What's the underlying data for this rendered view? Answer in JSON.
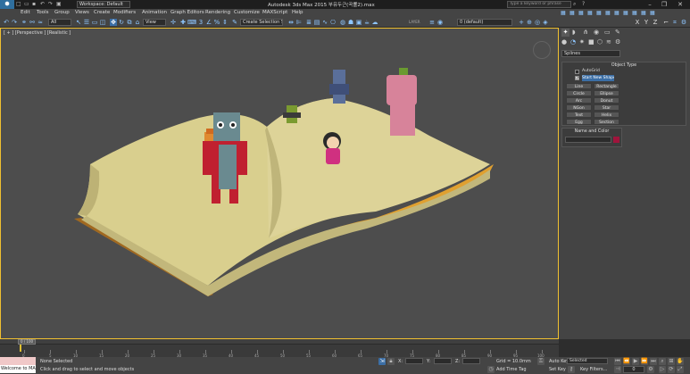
{
  "title": {
    "workspace": "Workspace: Default",
    "center": "Autodesk 3ds Max  2015   부유두근(곡률2).max",
    "search_placeholder": "Type a keyword or phrase"
  },
  "menu": [
    "Edit",
    "Tools",
    "Group",
    "Views",
    "Create",
    "Modifiers",
    "Animation",
    "Graph Editors",
    "Rendering",
    "Customize",
    "MAXScript",
    "Help"
  ],
  "toolbar": {
    "selection_filter": "All",
    "ref_coord": "View",
    "selection_set": "Create Selection Se",
    "layer": "0 (default)"
  },
  "viewport": {
    "label": "[ + ] [Perspective ] [Realistic ]"
  },
  "command_panel": {
    "category": "Splines",
    "object_type_title": "Object Type",
    "autogrid": "AutoGrid",
    "start_new_shape": "Start New Shape",
    "buttons": [
      "Line",
      "Rectangle",
      "Circle",
      "Ellipse",
      "Arc",
      "Donut",
      "NGon",
      "Star",
      "Text",
      "Helix",
      "Egg",
      "Section"
    ],
    "name_color_title": "Name and Color",
    "object_color": "#a0143c"
  },
  "timeline": {
    "frame": "0 / 100",
    "ticks": [
      "0",
      "5",
      "10",
      "15",
      "20",
      "25",
      "30",
      "35",
      "40",
      "45",
      "50",
      "55",
      "60",
      "65",
      "70",
      "75",
      "80",
      "85",
      "90",
      "95",
      "100"
    ]
  },
  "status": {
    "maxscript": "Welcome to MA",
    "selection": "None Selected",
    "prompt": "Click and drag to select and move objects",
    "grid": "Grid = 10.0mm",
    "add_time_tag": "Add Time Tag",
    "auto_key": "Auto Key",
    "set_key": "Set Key",
    "key_mode": "Selected",
    "key_filters": "Key Filters...",
    "frame_value": "0"
  },
  "colors": {
    "book_page": "#d9cf8e",
    "book_cover": "#e0a030",
    "viewport_bg": "#4d4d4d",
    "accent": "#8ec6ff"
  }
}
